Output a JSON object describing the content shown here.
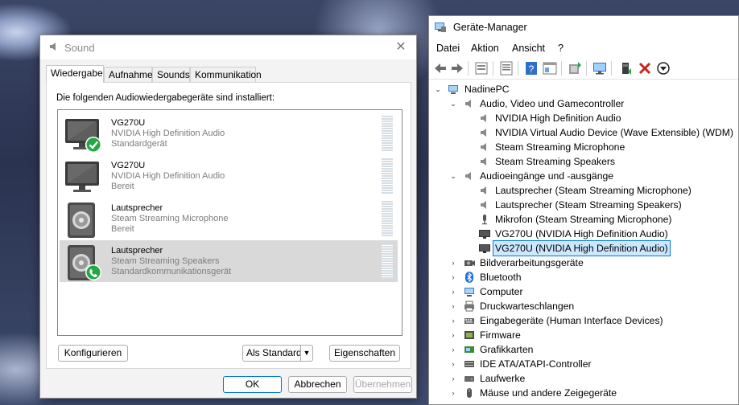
{
  "sound": {
    "title": "Sound",
    "close": "✕",
    "tabs": [
      "Wiedergabe",
      "Aufnahme",
      "Sounds",
      "Kommunikation"
    ],
    "intro": "Die folgenden Audiowiedergabegeräte sind installiert:",
    "devices": [
      {
        "name": "VG270U",
        "driver": "NVIDIA High Definition Audio",
        "status": "Standardgerät",
        "icon": "monitor-icon",
        "badge": "default-check-badge"
      },
      {
        "name": "VG270U",
        "driver": "NVIDIA High Definition Audio",
        "status": "Bereit",
        "icon": "monitor-icon",
        "badge": ""
      },
      {
        "name": "Lautsprecher",
        "driver": "Steam Streaming Microphone",
        "status": "Bereit",
        "icon": "speaker-icon",
        "badge": ""
      },
      {
        "name": "Lautsprecher",
        "driver": "Steam Streaming Speakers",
        "status": "Standardkommunikationsgerät",
        "icon": "speaker-icon",
        "badge": "communication-phone-badge"
      }
    ],
    "buttons": {
      "configure": "Konfigurieren",
      "set_default": "Als Standard",
      "properties": "Eigenschaften",
      "ok": "OK",
      "cancel": "Abbrechen",
      "apply": "Übernehmen"
    }
  },
  "device_manager": {
    "title": "Geräte-Manager",
    "menu": [
      "Datei",
      "Aktion",
      "Ansicht",
      "?"
    ],
    "toolbar_icons": [
      "back-arrow-icon",
      "forward-arrow-icon",
      "device-list-icon",
      "properties-icon",
      "help-icon",
      "view-icon",
      "update-driver-icon",
      "monitor-scan-icon",
      "add-device-icon",
      "remove-device-icon",
      "download-icon"
    ],
    "tree": [
      {
        "label": "NadinePC",
        "level": 0,
        "expanded": true,
        "icon": "computer-icon"
      },
      {
        "label": "Audio, Video und Gamecontroller",
        "level": 1,
        "expanded": true,
        "icon": "speaker-icon"
      },
      {
        "label": "NVIDIA High Definition Audio",
        "level": 2,
        "icon": "speaker-icon"
      },
      {
        "label": "NVIDIA Virtual Audio Device (Wave Extensible) (WDM)",
        "level": 2,
        "icon": "speaker-icon"
      },
      {
        "label": "Steam Streaming Microphone",
        "level": 2,
        "icon": "speaker-icon"
      },
      {
        "label": "Steam Streaming Speakers",
        "level": 2,
        "icon": "speaker-icon"
      },
      {
        "label": "Audioeingänge und -ausgänge",
        "level": 1,
        "expanded": true,
        "icon": "speaker-icon"
      },
      {
        "label": "Lautsprecher (Steam Streaming Microphone)",
        "level": 2,
        "icon": "speaker-icon"
      },
      {
        "label": "Lautsprecher (Steam Streaming Speakers)",
        "level": 2,
        "icon": "speaker-icon"
      },
      {
        "label": "Mikrofon (Steam Streaming Microphone)",
        "level": 2,
        "icon": "microphone-icon"
      },
      {
        "label": "VG270U (NVIDIA High Definition Audio)",
        "level": 2,
        "icon": "monitor-icon"
      },
      {
        "label": "VG270U (NVIDIA High Definition Audio)",
        "level": 2,
        "icon": "monitor-icon",
        "selected": true
      },
      {
        "label": "Bildverarbeitungsgeräte",
        "level": 1,
        "expanded": false,
        "icon": "camera-icon"
      },
      {
        "label": "Bluetooth",
        "level": 1,
        "expanded": false,
        "icon": "bluetooth-icon"
      },
      {
        "label": "Computer",
        "level": 1,
        "expanded": false,
        "icon": "computer-icon"
      },
      {
        "label": "Druckwarteschlangen",
        "level": 1,
        "expanded": false,
        "icon": "printer-icon"
      },
      {
        "label": "Eingabegeräte (Human Interface Devices)",
        "level": 1,
        "expanded": false,
        "icon": "hid-icon"
      },
      {
        "label": "Firmware",
        "level": 1,
        "expanded": false,
        "icon": "firmware-icon"
      },
      {
        "label": "Grafikkarten",
        "level": 1,
        "expanded": false,
        "icon": "display-adapter-icon"
      },
      {
        "label": "IDE ATA/ATAPI-Controller",
        "level": 1,
        "expanded": false,
        "icon": "ide-controller-icon"
      },
      {
        "label": "Laufwerke",
        "level": 1,
        "expanded": false,
        "icon": "disk-drive-icon"
      },
      {
        "label": "Mäuse und andere Zeigegeräte",
        "level": 1,
        "expanded": false,
        "icon": "mouse-icon"
      }
    ]
  }
}
